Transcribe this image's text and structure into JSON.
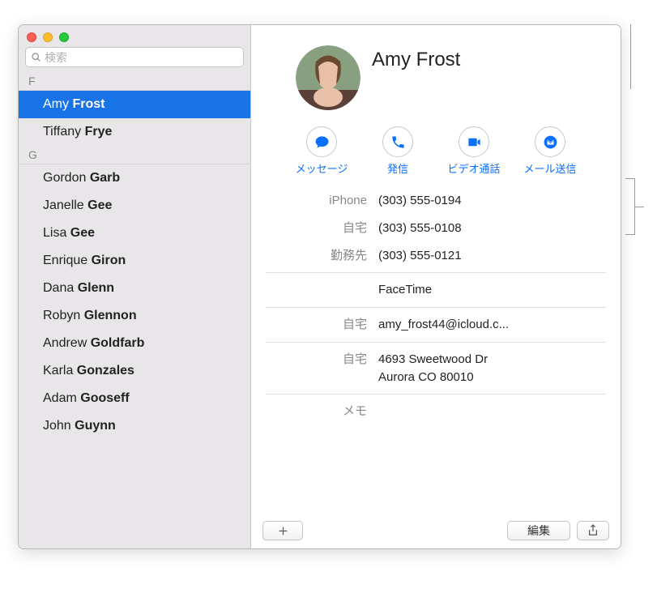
{
  "search": {
    "placeholder": "検索"
  },
  "sections": [
    {
      "letter": "F",
      "contacts": [
        {
          "first": "Amy",
          "last": "Frost",
          "selected": true
        },
        {
          "first": "Tiffany",
          "last": "Frye",
          "selected": false
        }
      ]
    },
    {
      "letter": "G",
      "contacts": [
        {
          "first": "Gordon",
          "last": "Garb",
          "selected": false
        },
        {
          "first": "Janelle",
          "last": "Gee",
          "selected": false
        },
        {
          "first": "Lisa",
          "last": "Gee",
          "selected": false
        },
        {
          "first": "Enrique",
          "last": "Giron",
          "selected": false
        },
        {
          "first": "Dana",
          "last": "Glenn",
          "selected": false
        },
        {
          "first": "Robyn",
          "last": "Glennon",
          "selected": false
        },
        {
          "first": "Andrew",
          "last": "Goldfarb",
          "selected": false
        },
        {
          "first": "Karla",
          "last": "Gonzales",
          "selected": false
        },
        {
          "first": "Adam",
          "last": "Gooseff",
          "selected": false
        },
        {
          "first": "John",
          "last": "Guynn",
          "selected": false
        }
      ]
    }
  ],
  "detail": {
    "name": "Amy Frost",
    "actions": {
      "message": "メッセージ",
      "call": "発信",
      "video": "ビデオ通話",
      "mail": "メール送信"
    },
    "phone_iphone_label": "iPhone",
    "phone_iphone_value": "(303) 555-0194",
    "phone_home_label": "自宅",
    "phone_home_value": "(303) 555-0108",
    "phone_work_label": "勤務先",
    "phone_work_value": "(303) 555-0121",
    "facetime_value": "FaceTime",
    "email_label": "自宅",
    "email_value": "amy_frost44@icloud.c...",
    "address_label": "自宅",
    "address_line1": "4693 Sweetwood Dr",
    "address_line2": "Aurora CO 80010",
    "memo_label": "メモ"
  },
  "buttons": {
    "edit": "編集"
  }
}
